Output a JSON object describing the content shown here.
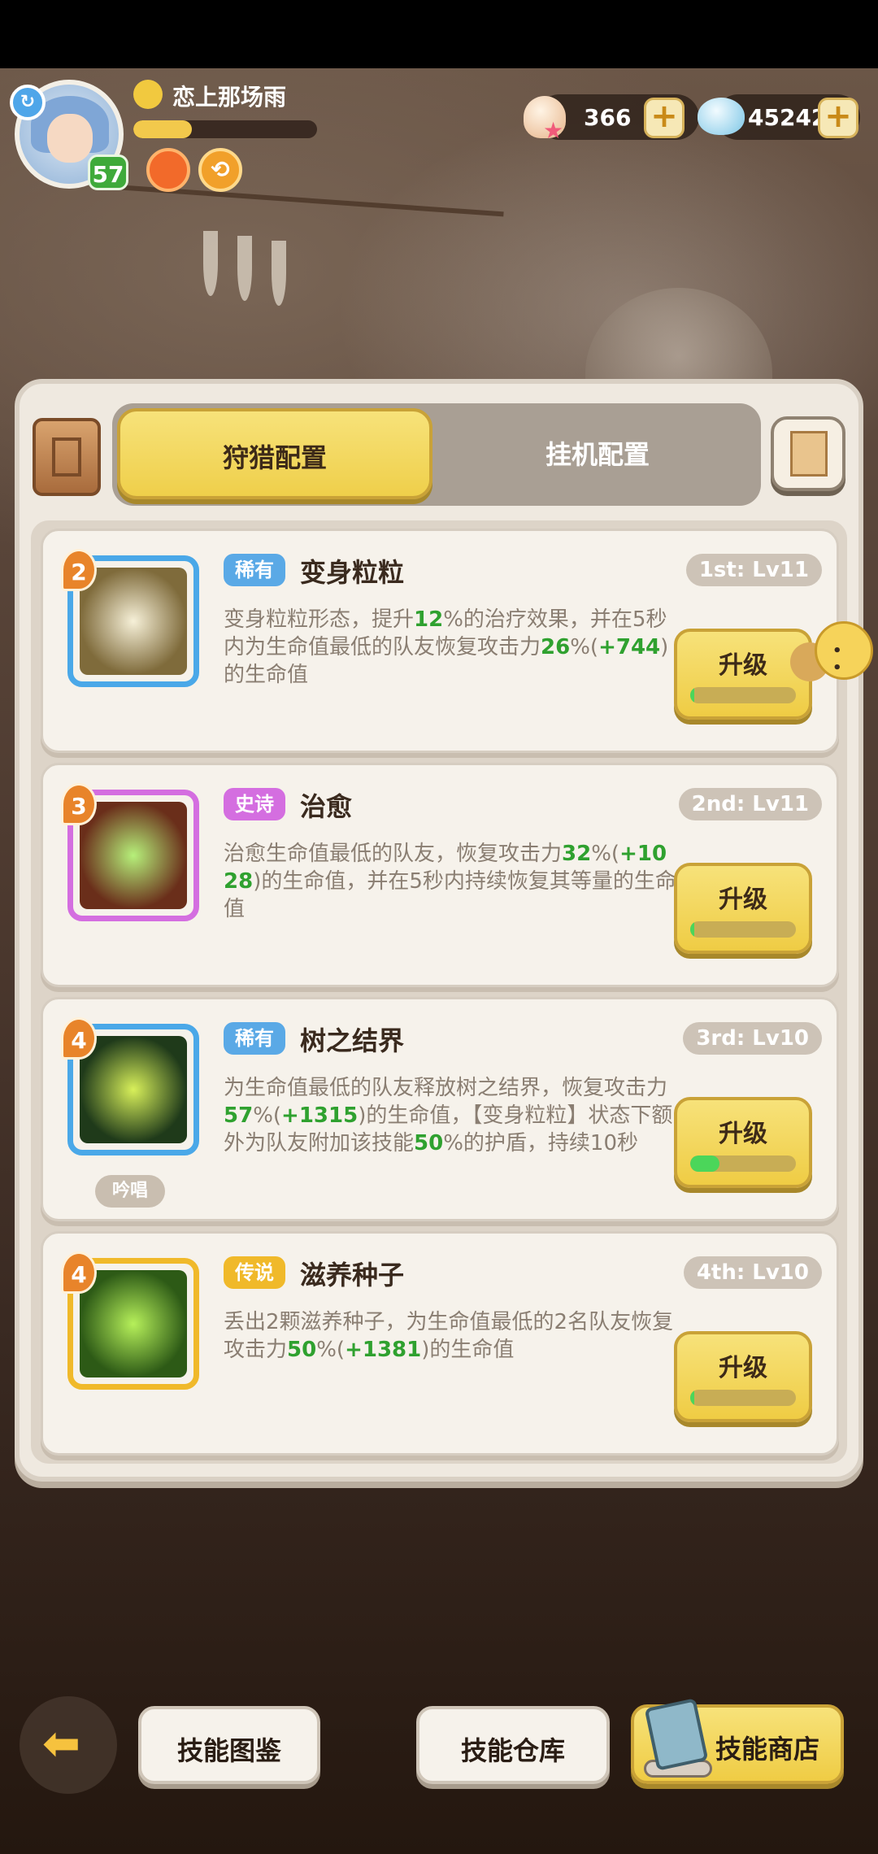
{
  "player": {
    "name": "恋上那场雨",
    "level": "57",
    "exp_progress": 0.32
  },
  "resources": {
    "shells": "366",
    "gems": "45242"
  },
  "tabs": {
    "active": "狩猎配置",
    "inactive": "挂机配置"
  },
  "skills": [
    {
      "slot_num": "2",
      "rarity": "稀有",
      "rarity_color": "#5aa9e6",
      "name": "变身粒粒",
      "slot_level": "1st: Lv11",
      "desc": [
        {
          "t": "变身粒粒形态，提升",
          "g": false
        },
        {
          "t": "12",
          "g": true
        },
        {
          "t": "%的治疗效果，并在5秒内为生命值最低的队友恢复攻击力",
          "g": false
        },
        {
          "t": "26",
          "g": true
        },
        {
          "t": "%(",
          "g": false
        },
        {
          "t": "+744",
          "g": true
        },
        {
          "t": ")的生命值",
          "g": false
        }
      ],
      "upgrade_label": "升级",
      "upgrade_progress": 0.04,
      "chant": ""
    },
    {
      "slot_num": "3",
      "rarity": "史诗",
      "rarity_color": "#d46ee0",
      "name": "治愈",
      "slot_level": "2nd: Lv11",
      "desc": [
        {
          "t": "治愈生命值最低的队友，恢复攻击力",
          "g": false
        },
        {
          "t": "32",
          "g": true
        },
        {
          "t": "%(",
          "g": false
        },
        {
          "t": "+1028",
          "g": true
        },
        {
          "t": ")的生命值，并在5秒内持续恢复其等量的生命值",
          "g": false
        }
      ],
      "upgrade_label": "升级",
      "upgrade_progress": 0.04,
      "chant": ""
    },
    {
      "slot_num": "4",
      "rarity": "稀有",
      "rarity_color": "#5aa9e6",
      "name": "树之结界",
      "slot_level": "3rd: Lv10",
      "desc": [
        {
          "t": "为生命值最低的队友释放树之结界，恢复攻击力",
          "g": false
        },
        {
          "t": "57",
          "g": true
        },
        {
          "t": "%(",
          "g": false
        },
        {
          "t": "+1315",
          "g": true
        },
        {
          "t": ")的生命值，【变身粒粒】状态下额外为队友附加该技能",
          "g": false
        },
        {
          "t": "50",
          "g": true
        },
        {
          "t": "%的护盾，持续10秒",
          "g": false
        }
      ],
      "upgrade_label": "升级",
      "upgrade_progress": 0.28,
      "chant": "吟唱"
    },
    {
      "slot_num": "4",
      "rarity": "传说",
      "rarity_color": "#f0b92a",
      "name": "滋养种子",
      "slot_level": "4th: Lv10",
      "desc": [
        {
          "t": "丢出2颗滋养种子，为生命值最低的2名队友恢复攻击力",
          "g": false
        },
        {
          "t": "50",
          "g": true
        },
        {
          "t": "%(",
          "g": false
        },
        {
          "t": "+1381",
          "g": true
        },
        {
          "t": ")的生命值",
          "g": false
        }
      ],
      "upgrade_label": "升级",
      "upgrade_progress": 0.04,
      "chant": ""
    }
  ],
  "bottom": {
    "codex": "技能图鉴",
    "storage": "技能仓库",
    "shop": "技能商店"
  },
  "icons": {
    "back": "back-arrow-icon",
    "sync": "sync-icon",
    "shell": "shell-icon",
    "gem": "gem-icon",
    "plus": "plus-icon"
  }
}
